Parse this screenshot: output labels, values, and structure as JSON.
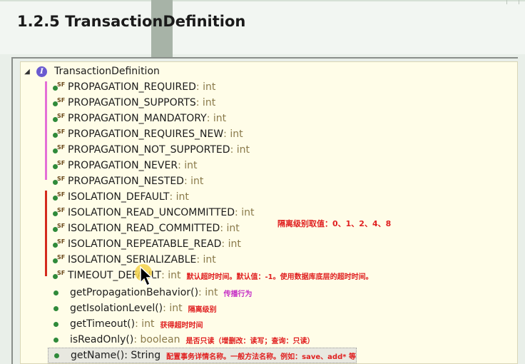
{
  "slide": {
    "title": "1.2.5 TransactionDefinition"
  },
  "tree": {
    "root": {
      "label": "TransactionDefinition"
    },
    "fields": [
      {
        "name": "PROPAGATION_REQUIRED",
        "type": " : int"
      },
      {
        "name": "PROPAGATION_SUPPORTS",
        "type": " : int"
      },
      {
        "name": "PROPAGATION_MANDATORY",
        "type": " : int"
      },
      {
        "name": "PROPAGATION_REQUIRES_NEW",
        "type": " : int"
      },
      {
        "name": "PROPAGATION_NOT_SUPPORTED",
        "type": " : int"
      },
      {
        "name": "PROPAGATION_NEVER",
        "type": " : int"
      },
      {
        "name": "PROPAGATION_NESTED",
        "type": " : int"
      },
      {
        "name": "ISOLATION_DEFAULT",
        "type": " : int"
      },
      {
        "name": "ISOLATION_READ_UNCOMMITTED",
        "type": " : int"
      },
      {
        "name": "ISOLATION_READ_COMMITTED",
        "type": " : int"
      },
      {
        "name": "ISOLATION_REPEATABLE_READ",
        "type": " : int"
      },
      {
        "name": "ISOLATION_SERIALIZABLE",
        "type": " : int"
      },
      {
        "name": "TIMEOUT_DEFAULT",
        "type": " : int",
        "note": "默认超时时间。默认值：-1。使用数据库底层的超时时间。"
      }
    ],
    "methods": [
      {
        "name": "getPropagationBehavior()",
        "type": " : int",
        "note": "传播行为"
      },
      {
        "name": "getIsolationLevel()",
        "type": " : int",
        "note": "隔离级别"
      },
      {
        "name": "getTimeout()",
        "type": " : int",
        "note": "获得超时时间"
      },
      {
        "name": "isReadOnly()",
        "type": " : boolean",
        "note": "是否只读（增删改：读写；查询：只读）"
      },
      {
        "name": "getName()",
        "type": " : String",
        "note": "配置事务详情名称。一般方法名称。例如：save、add* 等"
      }
    ],
    "isolation_note": "隔离级别取值：0、1、2、4、8"
  },
  "icons": {
    "interface": "interface-icon",
    "field": "static-final-field-icon",
    "method": "public-method-icon",
    "expand": "expand-triangle-icon"
  },
  "colors": {
    "panel_bg": "#fffde8",
    "annotation_red": "#e02020",
    "annotation_magenta": "#c62fc6",
    "propagation_brace": "#e46fd6",
    "isolation_brace": "#d42b1d"
  }
}
